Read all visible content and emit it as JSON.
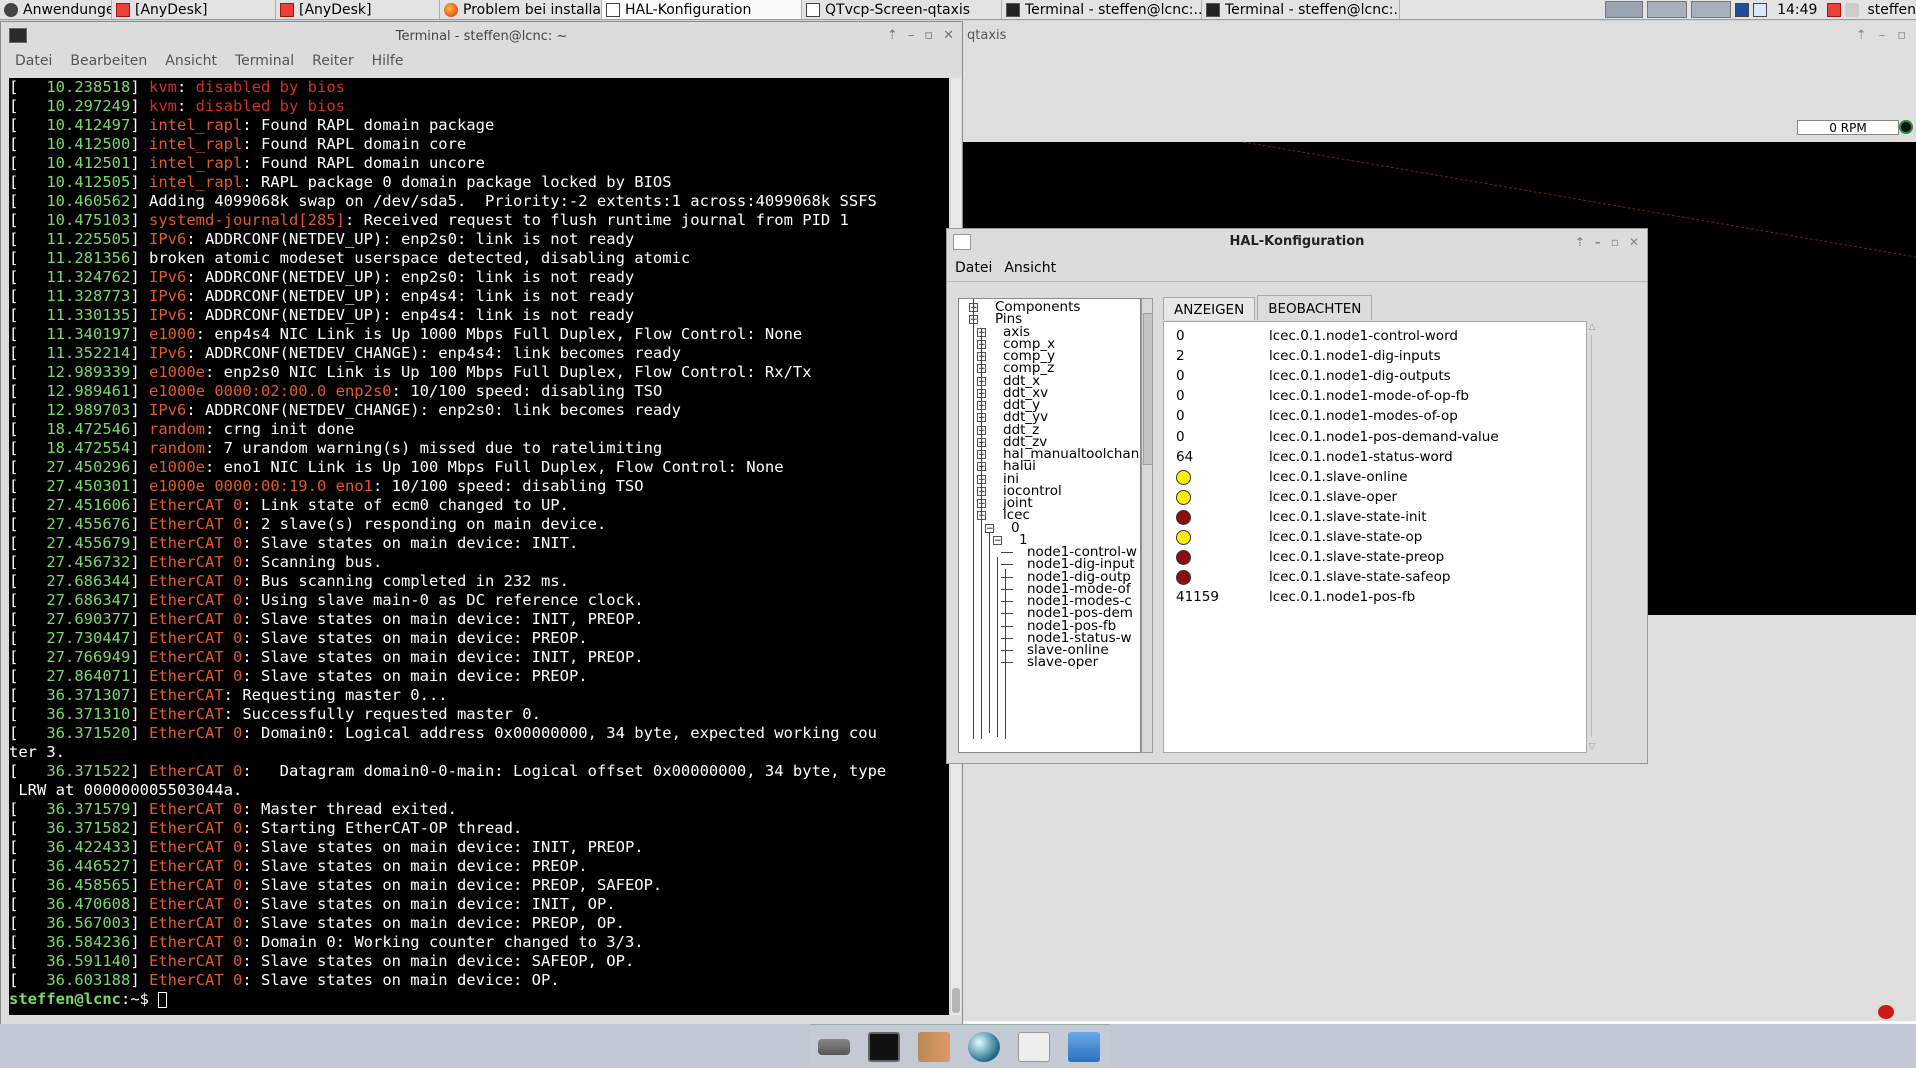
{
  "taskbar": {
    "items": [
      {
        "label": "Anwendungen",
        "icon": "app-menu-icon",
        "active": false
      },
      {
        "label": "[AnyDesk]",
        "icon": "anydesk-icon",
        "active": false
      },
      {
        "label": "[AnyDesk]",
        "icon": "anydesk-icon",
        "active": false
      },
      {
        "label": "Problem bei installation...",
        "icon": "firefox-icon",
        "active": false
      },
      {
        "label": "HAL-Konfiguration",
        "icon": "window-icon",
        "active": true
      },
      {
        "label": "QTvcp-Screen-qtaxis",
        "icon": "window-icon",
        "active": false
      },
      {
        "label": "Terminal - steffen@lcnc:...",
        "icon": "terminal-icon",
        "active": false
      },
      {
        "label": "Terminal - steffen@lcnc:...",
        "icon": "terminal-icon",
        "active": false
      }
    ],
    "clock": "14:49",
    "user": "steffen"
  },
  "terminal": {
    "title": "Terminal - steffen@lcnc: ~",
    "menu": [
      "Datei",
      "Bearbeiten",
      "Ansicht",
      "Terminal",
      "Reiter",
      "Hilfe"
    ],
    "lines": [
      {
        "ts": "   10.238518",
        "src": "kvm",
        "msg": "disabled by bios",
        "err": true
      },
      {
        "ts": "   10.297249",
        "src": "kvm",
        "msg": "disabled by bios",
        "err": true
      },
      {
        "ts": "   10.412497",
        "src": "intel_rapl",
        "msg": "Found RAPL domain package"
      },
      {
        "ts": "   10.412500",
        "src": "intel_rapl",
        "msg": "Found RAPL domain core"
      },
      {
        "ts": "   10.412501",
        "src": "intel_rapl",
        "msg": "Found RAPL domain uncore"
      },
      {
        "ts": "   10.412505",
        "src": "intel_rapl",
        "msg": "RAPL package 0 domain package locked by BIOS"
      },
      {
        "ts": "   10.460562",
        "plain": "Adding 4099068k swap on /dev/sda5.  Priority:-2 extents:1 across:4099068k SSFS"
      },
      {
        "ts": "   10.475103",
        "src": "systemd-journald[285]",
        "msg": "Received request to flush runtime journal from PID 1"
      },
      {
        "ts": "   11.225505",
        "src": "IPv6",
        "msg": "ADDRCONF(NETDEV_UP): enp2s0: link is not ready"
      },
      {
        "ts": "   11.281356",
        "plain": "broken atomic modeset userspace detected, disabling atomic"
      },
      {
        "ts": "   11.324762",
        "src": "IPv6",
        "msg": "ADDRCONF(NETDEV_UP): enp2s0: link is not ready"
      },
      {
        "ts": "   11.328773",
        "src": "IPv6",
        "msg": "ADDRCONF(NETDEV_UP): enp4s4: link is not ready"
      },
      {
        "ts": "   11.330135",
        "src": "IPv6",
        "msg": "ADDRCONF(NETDEV_UP): enp4s4: link is not ready"
      },
      {
        "ts": "   11.340197",
        "src": "e1000",
        "msg": "enp4s4 NIC Link is Up 1000 Mbps Full Duplex, Flow Control: None"
      },
      {
        "ts": "   11.352214",
        "src": "IPv6",
        "msg": "ADDRCONF(NETDEV_CHANGE): enp4s4: link becomes ready"
      },
      {
        "ts": "   12.989339",
        "src": "e1000e",
        "msg": "enp2s0 NIC Link is Up 100 Mbps Full Duplex, Flow Control: Rx/Tx"
      },
      {
        "ts": "   12.989461",
        "src": "e1000e 0000:02:00.0 enp2s0",
        "msg": "10/100 speed: disabling TSO"
      },
      {
        "ts": "   12.989703",
        "src": "IPv6",
        "msg": "ADDRCONF(NETDEV_CHANGE): enp2s0: link becomes ready"
      },
      {
        "ts": "   18.472546",
        "src": "random",
        "msg": "crng init done"
      },
      {
        "ts": "   18.472554",
        "src": "random",
        "msg": "7 urandom warning(s) missed due to ratelimiting"
      },
      {
        "ts": "   27.450296",
        "src": "e1000e",
        "msg": "eno1 NIC Link is Up 100 Mbps Full Duplex, Flow Control: None"
      },
      {
        "ts": "   27.450301",
        "src": "e1000e 0000:00:19.0 eno1",
        "msg": "10/100 speed: disabling TSO"
      },
      {
        "ts": "   27.451606",
        "src": "EtherCAT 0",
        "msg": "Link state of ecm0 changed to UP."
      },
      {
        "ts": "   27.455676",
        "src": "EtherCAT 0",
        "msg": "2 slave(s) responding on main device."
      },
      {
        "ts": "   27.455679",
        "src": "EtherCAT 0",
        "msg": "Slave states on main device: INIT."
      },
      {
        "ts": "   27.456732",
        "src": "EtherCAT 0",
        "msg": "Scanning bus."
      },
      {
        "ts": "   27.686344",
        "src": "EtherCAT 0",
        "msg": "Bus scanning completed in 232 ms."
      },
      {
        "ts": "   27.686347",
        "src": "EtherCAT 0",
        "msg": "Using slave main-0 as DC reference clock."
      },
      {
        "ts": "   27.690377",
        "src": "EtherCAT 0",
        "msg": "Slave states on main device: INIT, PREOP."
      },
      {
        "ts": "   27.730447",
        "src": "EtherCAT 0",
        "msg": "Slave states on main device: PREOP."
      },
      {
        "ts": "   27.766949",
        "src": "EtherCAT 0",
        "msg": "Slave states on main device: INIT, PREOP."
      },
      {
        "ts": "   27.864071",
        "src": "EtherCAT 0",
        "msg": "Slave states on main device: PREOP."
      },
      {
        "ts": "   36.371307",
        "src": "EtherCAT",
        "msg": "Requesting master 0..."
      },
      {
        "ts": "   36.371310",
        "src": "EtherCAT",
        "msg": "Successfully requested master 0."
      },
      {
        "ts": "   36.371520",
        "src": "EtherCAT 0",
        "msg": "Domain0: Logical address 0x00000000, 34 byte, expected working cou"
      },
      {
        "raw": "ter 3."
      },
      {
        "ts": "   36.371522",
        "src": "EtherCAT 0",
        "msg": "  Datagram domain0-0-main: Logical offset 0x00000000, 34 byte, type"
      },
      {
        "raw": " LRW at 000000005503044a."
      },
      {
        "ts": "   36.371579",
        "src": "EtherCAT 0",
        "msg": "Master thread exited."
      },
      {
        "ts": "   36.371582",
        "src": "EtherCAT 0",
        "msg": "Starting EtherCAT-OP thread."
      },
      {
        "ts": "   36.422433",
        "src": "EtherCAT 0",
        "msg": "Slave states on main device: INIT, PREOP."
      },
      {
        "ts": "   36.446527",
        "src": "EtherCAT 0",
        "msg": "Slave states on main device: PREOP."
      },
      {
        "ts": "   36.458565",
        "src": "EtherCAT 0",
        "msg": "Slave states on main device: PREOP, SAFEOP."
      },
      {
        "ts": "   36.470608",
        "src": "EtherCAT 0",
        "msg": "Slave states on main device: INIT, OP."
      },
      {
        "ts": "   36.567003",
        "src": "EtherCAT 0",
        "msg": "Slave states on main device: PREOP, OP."
      },
      {
        "ts": "   36.584236",
        "src": "EtherCAT 0",
        "msg": "Domain 0: Working counter changed to 3/3."
      },
      {
        "ts": "   36.591140",
        "src": "EtherCAT 0",
        "msg": "Slave states on main device: SAFEOP, OP."
      },
      {
        "ts": "   36.603188",
        "src": "EtherCAT 0",
        "msg": "Slave states on main device: OP."
      }
    ],
    "prompt": "steffen@lcnc",
    "prompt_path": ":~$ "
  },
  "qtaxis": {
    "title": "qtaxis",
    "rpm": "0 RPM"
  },
  "hal": {
    "title": "HAL-Konfiguration",
    "menu": [
      "Datei",
      "Ansicht"
    ],
    "tabs": [
      "ANZEIGEN",
      "BEOBACHTEN"
    ],
    "active_tab": 1,
    "tree": [
      {
        "label": "Components",
        "depth": 0,
        "expander": "plus"
      },
      {
        "label": "Pins",
        "depth": 0,
        "expander": "minus"
      },
      {
        "label": "axis",
        "depth": 1,
        "expander": "plus"
      },
      {
        "label": "comp_x",
        "depth": 1,
        "expander": "plus"
      },
      {
        "label": "comp_y",
        "depth": 1,
        "expander": "plus"
      },
      {
        "label": "comp_z",
        "depth": 1,
        "expander": "plus"
      },
      {
        "label": "ddt_x",
        "depth": 1,
        "expander": "plus"
      },
      {
        "label": "ddt_xv",
        "depth": 1,
        "expander": "plus"
      },
      {
        "label": "ddt_y",
        "depth": 1,
        "expander": "plus"
      },
      {
        "label": "ddt_yv",
        "depth": 1,
        "expander": "plus"
      },
      {
        "label": "ddt_z",
        "depth": 1,
        "expander": "plus"
      },
      {
        "label": "ddt_zv",
        "depth": 1,
        "expander": "plus"
      },
      {
        "label": "hal_manualtoolchan",
        "depth": 1,
        "expander": "plus"
      },
      {
        "label": "halui",
        "depth": 1,
        "expander": "plus"
      },
      {
        "label": "ini",
        "depth": 1,
        "expander": "plus"
      },
      {
        "label": "iocontrol",
        "depth": 1,
        "expander": "plus"
      },
      {
        "label": "joint",
        "depth": 1,
        "expander": "plus"
      },
      {
        "label": "lcec",
        "depth": 1,
        "expander": "minus"
      },
      {
        "label": "0",
        "depth": 2,
        "expander": "minus"
      },
      {
        "label": "1",
        "depth": 3,
        "expander": "minus"
      },
      {
        "label": "node1-control-w",
        "depth": 4,
        "expander": "none"
      },
      {
        "label": "node1-dig-input",
        "depth": 4,
        "expander": "none"
      },
      {
        "label": "node1-dig-outp",
        "depth": 4,
        "expander": "none"
      },
      {
        "label": "node1-mode-of",
        "depth": 4,
        "expander": "none"
      },
      {
        "label": "node1-modes-c",
        "depth": 4,
        "expander": "none"
      },
      {
        "label": "node1-pos-dem",
        "depth": 4,
        "expander": "none"
      },
      {
        "label": "node1-pos-fb",
        "depth": 4,
        "expander": "none"
      },
      {
        "label": "node1-status-w",
        "depth": 4,
        "expander": "none"
      },
      {
        "label": "slave-online",
        "depth": 4,
        "expander": "none"
      },
      {
        "label": "slave-oper",
        "depth": 4,
        "expander": "none"
      }
    ],
    "watch": [
      {
        "value": "0",
        "name": "lcec.0.1.node1-control-word"
      },
      {
        "value": "2",
        "name": "lcec.0.1.node1-dig-inputs"
      },
      {
        "value": "0",
        "name": "lcec.0.1.node1-dig-outputs"
      },
      {
        "value": "0",
        "name": "lcec.0.1.node1-mode-of-op-fb"
      },
      {
        "value": "0",
        "name": "lcec.0.1.node1-modes-of-op"
      },
      {
        "value": "0",
        "name": "lcec.0.1.node1-pos-demand-value"
      },
      {
        "value": "64",
        "name": "lcec.0.1.node1-status-word"
      },
      {
        "led": "yellow",
        "name": "lcec.0.1.slave-online"
      },
      {
        "led": "yellow",
        "name": "lcec.0.1.slave-oper"
      },
      {
        "led": "red",
        "name": "lcec.0.1.slave-state-init"
      },
      {
        "led": "yellow",
        "name": "lcec.0.1.slave-state-op"
      },
      {
        "led": "red",
        "name": "lcec.0.1.slave-state-preop"
      },
      {
        "led": "red",
        "name": "lcec.0.1.slave-state-safeop"
      },
      {
        "value": "41159",
        "name": "lcec.0.1.node1-pos-fb"
      }
    ]
  },
  "dock": {
    "items": [
      "drive-icon",
      "terminal-icon",
      "notes-icon",
      "browser-icon",
      "search-icon",
      "folder-icon"
    ]
  }
}
